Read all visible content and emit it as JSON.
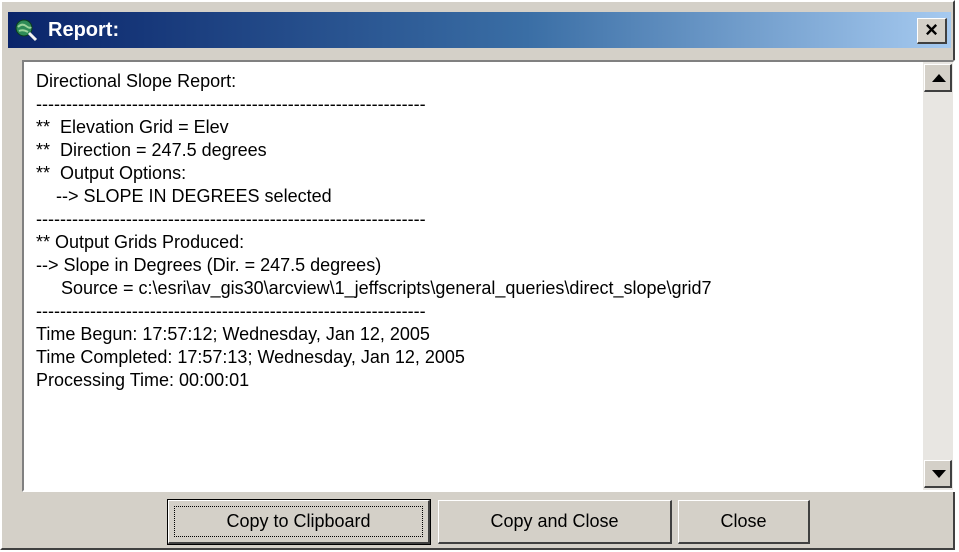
{
  "window": {
    "title": "Report:",
    "close_label": "×"
  },
  "report": {
    "text": "Directional Slope Report:\n-----------------------------------------------------------------\n**  Elevation Grid = Elev\n**  Direction = 247.5 degrees\n**  Output Options:\n    --> SLOPE IN DEGREES selected\n-----------------------------------------------------------------\n** Output Grids Produced:\n--> Slope in Degrees (Dir. = 247.5 degrees)\n     Source = c:\\esri\\av_gis30\\arcview\\1_jeffscripts\\general_queries\\direct_slope\\grid7\n-----------------------------------------------------------------\nTime Begun: 17:57:12; Wednesday, Jan 12, 2005\nTime Completed: 17:57:13; Wednesday, Jan 12, 2005\nProcessing Time: 00:00:01"
  },
  "buttons": {
    "copy_clipboard": "Copy to Clipboard",
    "copy_close": "Copy and Close",
    "close": "Close"
  },
  "icons": {
    "title": "globe-magnifier-icon",
    "close": "close-icon",
    "scroll_up": "arrow-up-icon",
    "scroll_down": "arrow-down-icon"
  },
  "colors": {
    "titlebar_start": "#0a246a",
    "titlebar_end": "#a6caf0",
    "dialog_face": "#d4d0c8"
  }
}
